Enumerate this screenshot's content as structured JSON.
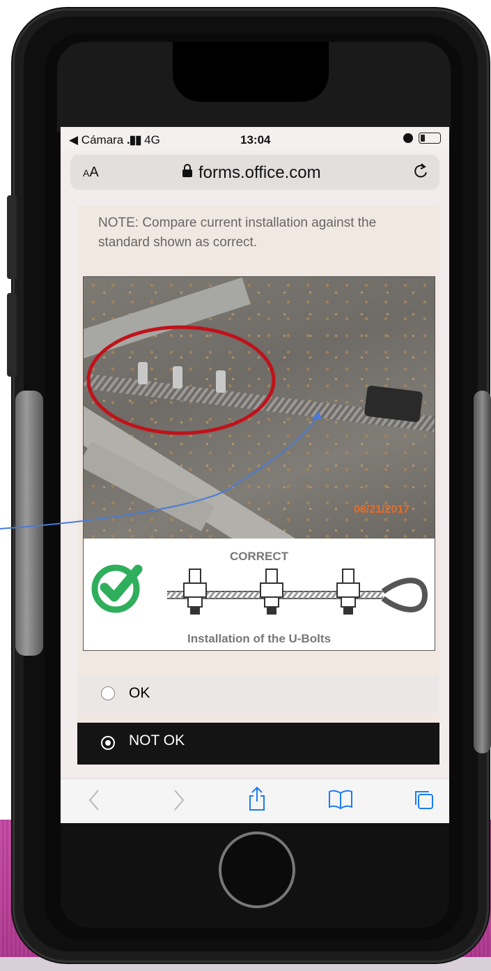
{
  "status_bar": {
    "back_app": "◀ Cámara",
    "signal": "4G",
    "time": "13:04"
  },
  "browser": {
    "text_size_button": "AA",
    "domain": "forms.office.com",
    "reload_icon": "reload-icon"
  },
  "question": {
    "note": "NOTE: Compare current installation against the standard shown as correct.",
    "photo_date_stamp": "08/21/2017",
    "diagram_title": "CORRECT",
    "diagram_caption": "Installation of the U-Bolts"
  },
  "answers": [
    {
      "label": "OK",
      "selected": false
    },
    {
      "label": "NOT OK",
      "selected": true
    }
  ],
  "toolbar": {
    "back": "back-icon",
    "forward": "forward-icon",
    "share": "share-icon",
    "bookmarks": "book-icon",
    "tabs": "tabs-icon"
  },
  "colors": {
    "highlight_circle": "#c0121a",
    "arrow_line": "#4a7bd6",
    "check_green": "#2fae5c",
    "selected_answer_bg": "#141414",
    "background_band": "#b53c93",
    "link_blue": "#1b7cf3"
  }
}
